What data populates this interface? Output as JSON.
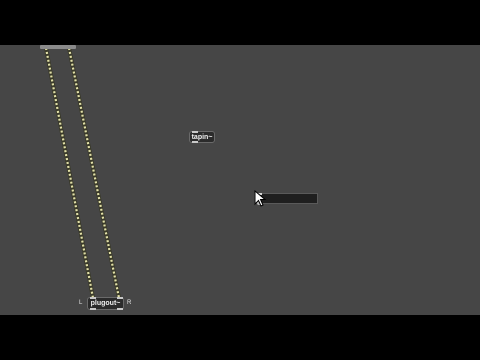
{
  "canvas": {
    "background": "#464646",
    "cord_color": "#d8d6a0",
    "objects": {
      "tapin": {
        "label": "tapin~"
      },
      "plugout": {
        "label": "plugout~",
        "left_channel": "L",
        "right_channel": "R"
      },
      "new_object": {
        "text": ""
      }
    },
    "cursor_icon": "arrow-cursor-icon"
  }
}
